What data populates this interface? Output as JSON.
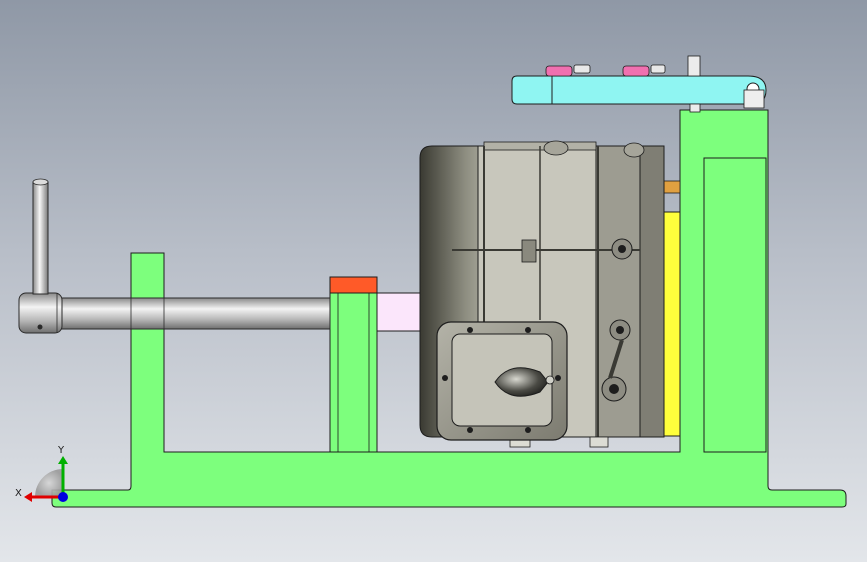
{
  "axes": {
    "x_label": "X",
    "y_label": "Y",
    "x_color": "#e00000",
    "y_color": "#00b000",
    "z_color": "#0000e0"
  },
  "colors": {
    "frame": "#7dff7d",
    "frame_edge": "#222222",
    "top_plate": "#8ff5f2",
    "side_plate": "#ffff3c",
    "clamp_pad": "#ff5a28",
    "pusher_block": "#fbe6fb",
    "shaft": "#c9c9c9",
    "housing": "#c7c6bc",
    "housing_dark": "#6c6c60",
    "cover_plate": "#9c9c90",
    "bolt_head": "#f070b0"
  }
}
